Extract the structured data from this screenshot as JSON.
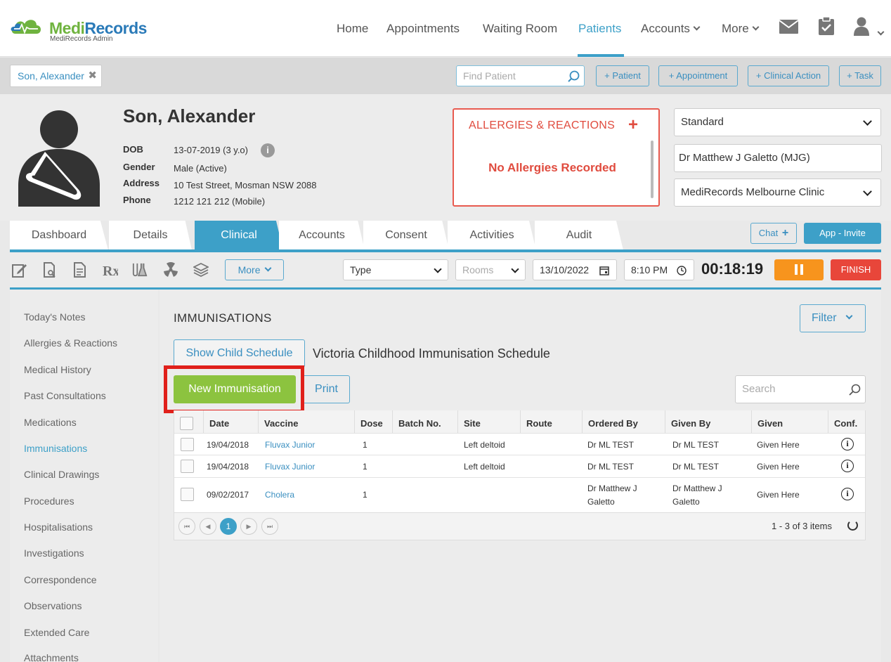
{
  "brand": {
    "name_part1": "Medi",
    "name_part2": "Records",
    "subtitle": "MediRecords Admin"
  },
  "nav": {
    "items": [
      "Home",
      "Appointments",
      "Waiting Room",
      "Patients",
      "Accounts",
      "More"
    ],
    "active": "Patients"
  },
  "patient_tab": {
    "label": "Son, Alexander"
  },
  "quick": {
    "find_placeholder": "Find Patient",
    "add_patient": "+ Patient",
    "add_appointment": "+ Appointment",
    "add_clinical_action": "+ Clinical Action",
    "add_task": "+ Task"
  },
  "patient": {
    "name": "Son, Alexander",
    "dob_label": "DOB",
    "dob": "13-07-2019 (3 y.o)",
    "gender_label": "Gender",
    "gender": "Male (Active)",
    "address_label": "Address",
    "address": "10 Test Street, Mosman NSW 2088",
    "phone_label": "Phone",
    "phone": "1212 121 212 (Mobile)"
  },
  "allergies": {
    "title": "ALLERGIES & REACTIONS",
    "empty": "No Allergies Recorded"
  },
  "selectors": {
    "billing": "Standard",
    "doctor": "Dr Matthew J Galetto (MJG)",
    "clinic": "MediRecords Melbourne Clinic"
  },
  "tabs": [
    "Dashboard",
    "Details",
    "Clinical",
    "Accounts",
    "Consent",
    "Activities",
    "Audit"
  ],
  "active_tab": "Clinical",
  "chat_label": "Chat",
  "app_invite_label": "App - Invite",
  "toolbar": {
    "more_label": "More",
    "type_value": "Type",
    "rooms_placeholder": "Rooms",
    "date": "13/10/2022",
    "time": "8:10 PM",
    "timer": "00:18:19",
    "finish_label": "FINISH"
  },
  "sidebar": {
    "items": [
      "Today's Notes",
      "Allergies & Reactions",
      "Medical History",
      "Past Consultations",
      "Medications",
      "Immunisations",
      "Clinical Drawings",
      "Procedures",
      "Hospitalisations",
      "Investigations",
      "Correspondence",
      "Observations",
      "Extended Care",
      "Attachments"
    ],
    "active": "Immunisations"
  },
  "immunisations": {
    "title": "IMMUNISATIONS",
    "filter_label": "Filter",
    "show_child_schedule": "Show Child Schedule",
    "schedule_name": "Victoria Childhood Immunisation Schedule",
    "new_button": "New Immunisation",
    "print_button": "Print",
    "search_placeholder": "Search",
    "columns": [
      "Date",
      "Vaccine",
      "Dose",
      "Batch No.",
      "Site",
      "Route",
      "Ordered By",
      "Given By",
      "Given",
      "Conf."
    ],
    "rows": [
      {
        "date": "19/04/2018",
        "vaccine": "Fluvax Junior",
        "dose": "1",
        "batch": "",
        "site": "Left deltoid",
        "route": "",
        "ordered_by": "Dr ML TEST",
        "given_by": "Dr ML TEST",
        "given": "Given Here"
      },
      {
        "date": "19/04/2018",
        "vaccine": "Fluvax Junior",
        "dose": "1",
        "batch": "",
        "site": "Left deltoid",
        "route": "",
        "ordered_by": "Dr ML TEST",
        "given_by": "Dr ML TEST",
        "given": "Given Here"
      },
      {
        "date": "09/02/2017",
        "vaccine": "Cholera",
        "dose": "1",
        "batch": "",
        "site": "",
        "route": "",
        "ordered_by_line1": "Dr Matthew J",
        "ordered_by_line2": "Galetto",
        "given_by_line1": "Dr Matthew J",
        "given_by_line2": "Galetto",
        "given": "Given Here"
      }
    ],
    "pager": {
      "current_page": "1",
      "info": "1 - 3 of 3 items"
    }
  },
  "colors": {
    "accent": "#3da0c8",
    "success": "#8cc33f",
    "danger": "#e8463a",
    "warning": "#f7941d",
    "highlight": "#e0201b"
  }
}
